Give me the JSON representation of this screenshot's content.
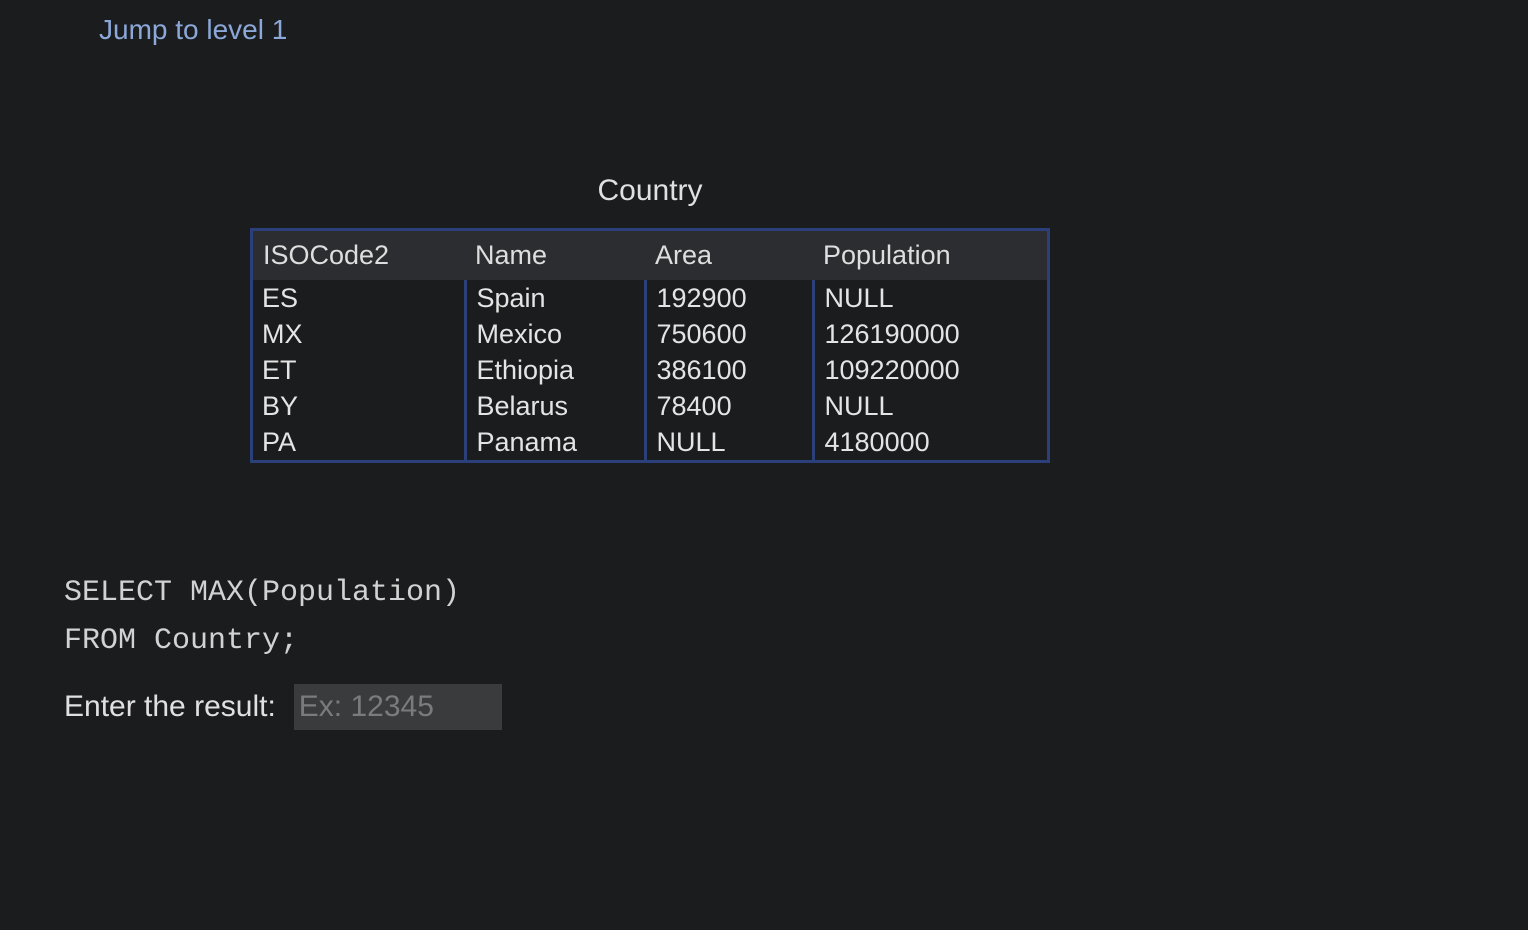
{
  "nav": {
    "jump_link": "Jump to level 1"
  },
  "table": {
    "caption": "Country",
    "columns": [
      "ISOCode2",
      "Name",
      "Area",
      "Population"
    ],
    "rows": [
      [
        "ES",
        "Spain",
        "192900",
        "NULL"
      ],
      [
        "MX",
        "Mexico",
        "750600",
        "126190000"
      ],
      [
        "ET",
        "Ethiopia",
        "386100",
        "109220000"
      ],
      [
        "BY",
        "Belarus",
        "78400",
        "NULL"
      ],
      [
        "PA",
        "Panama",
        "NULL",
        "4180000"
      ]
    ]
  },
  "query": {
    "line1": "SELECT MAX(Population)",
    "line2": "FROM Country;"
  },
  "answer": {
    "label": "Enter the result:",
    "placeholder": "Ex: 12345",
    "value": ""
  },
  "colors": {
    "background": "#1b1c1e",
    "link": "#8ca8d8",
    "table_border": "#2b3f7a",
    "header_bg": "#2c2d30",
    "input_bg": "#3a3b3d"
  }
}
